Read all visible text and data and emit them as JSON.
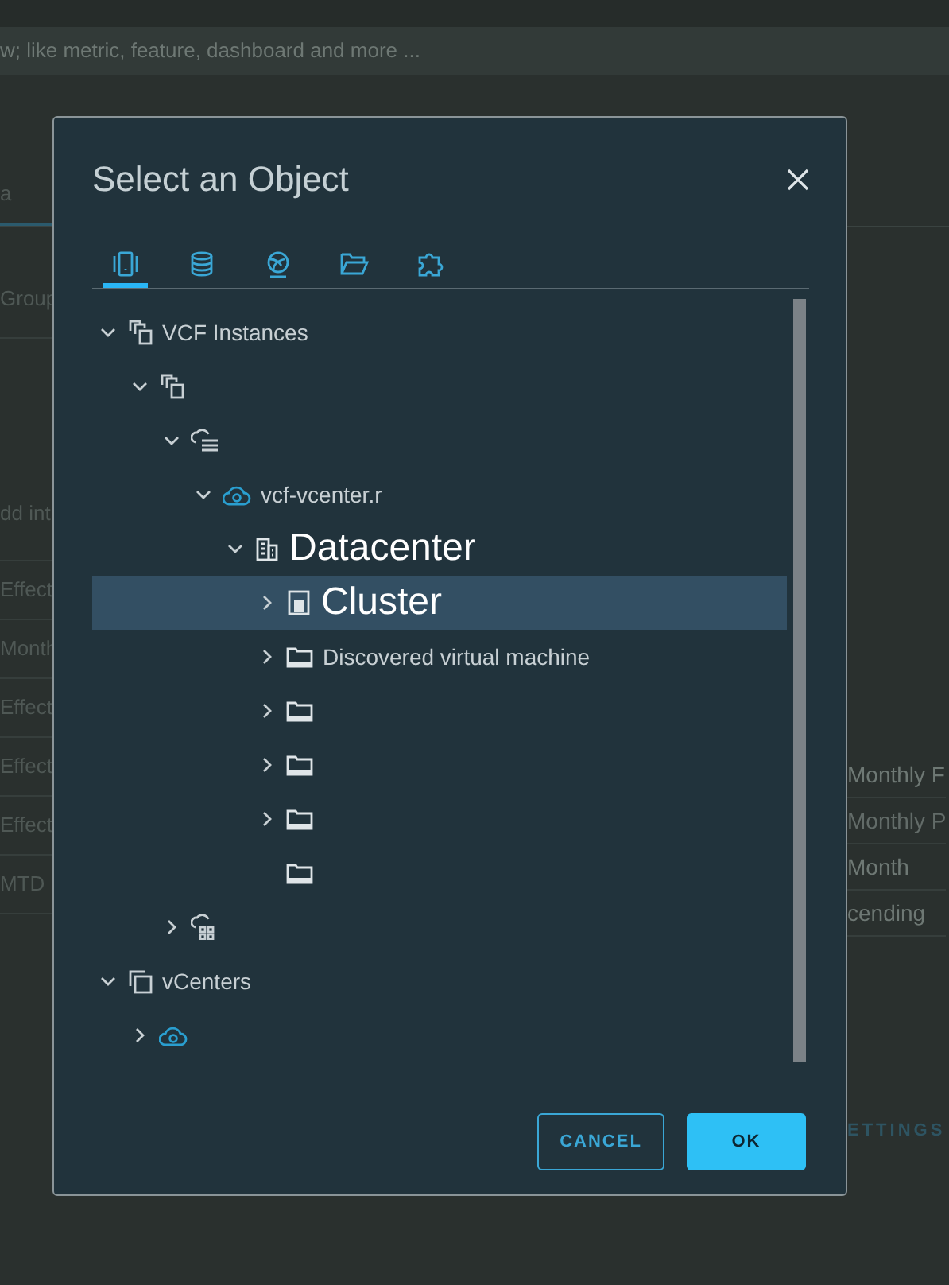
{
  "background": {
    "search": {
      "placeholder": "w; like metric, feature, dashboard and more ..."
    },
    "tab": {
      "label": "a",
      "selected": true
    },
    "left_column": [
      "Group",
      "dd int",
      "Effect",
      "Month",
      "Effect",
      "Effect",
      "Effect",
      "MTD"
    ],
    "right_column": [
      "Monthly F",
      "Monthly P",
      "Month",
      "cending"
    ],
    "settings_link": "ETTINGS"
  },
  "dialog": {
    "title": "Select an Object",
    "tabs": [
      {
        "kind": "hosts",
        "selected": true
      },
      {
        "kind": "storage",
        "selected": false
      },
      {
        "kind": "network",
        "selected": false
      },
      {
        "kind": "folders",
        "selected": false
      },
      {
        "kind": "extensions",
        "selected": false
      }
    ],
    "tree": [
      {
        "label": "VCF Instances",
        "kind": "instances",
        "expanded": true,
        "children": [
          {
            "kind": "instances",
            "expanded": true,
            "children": [
              {
                "kind": "cloud-stack",
                "expanded": true,
                "children": [
                  {
                    "label": "vcf-vcenter.r",
                    "kind": "vcenter",
                    "expanded": true,
                    "children": [
                      {
                        "label": "Datacenter",
                        "kind": "datacenter",
                        "expanded": true,
                        "emphasized": true,
                        "children": [
                          {
                            "label": "Cluster",
                            "kind": "cluster",
                            "expanded": false,
                            "emphasized": true,
                            "selected": true
                          },
                          {
                            "label": "Discovered virtual machine",
                            "kind": "folder",
                            "expanded": false
                          },
                          {
                            "kind": "folder",
                            "expanded": false
                          },
                          {
                            "kind": "folder",
                            "expanded": false
                          },
                          {
                            "kind": "folder",
                            "expanded": false
                          },
                          {
                            "kind": "folder",
                            "leaf": true
                          }
                        ]
                      }
                    ]
                  }
                ]
              },
              {
                "kind": "cloud-grid",
                "expanded": false
              }
            ]
          }
        ]
      },
      {
        "label": "vCenters",
        "kind": "vcenters",
        "expanded": true,
        "children": [
          {
            "kind": "vcenter",
            "expanded": false
          }
        ]
      }
    ],
    "buttons": [
      {
        "label": "CANCEL",
        "kind": "secondary"
      },
      {
        "label": "OK",
        "kind": "primary"
      }
    ]
  }
}
